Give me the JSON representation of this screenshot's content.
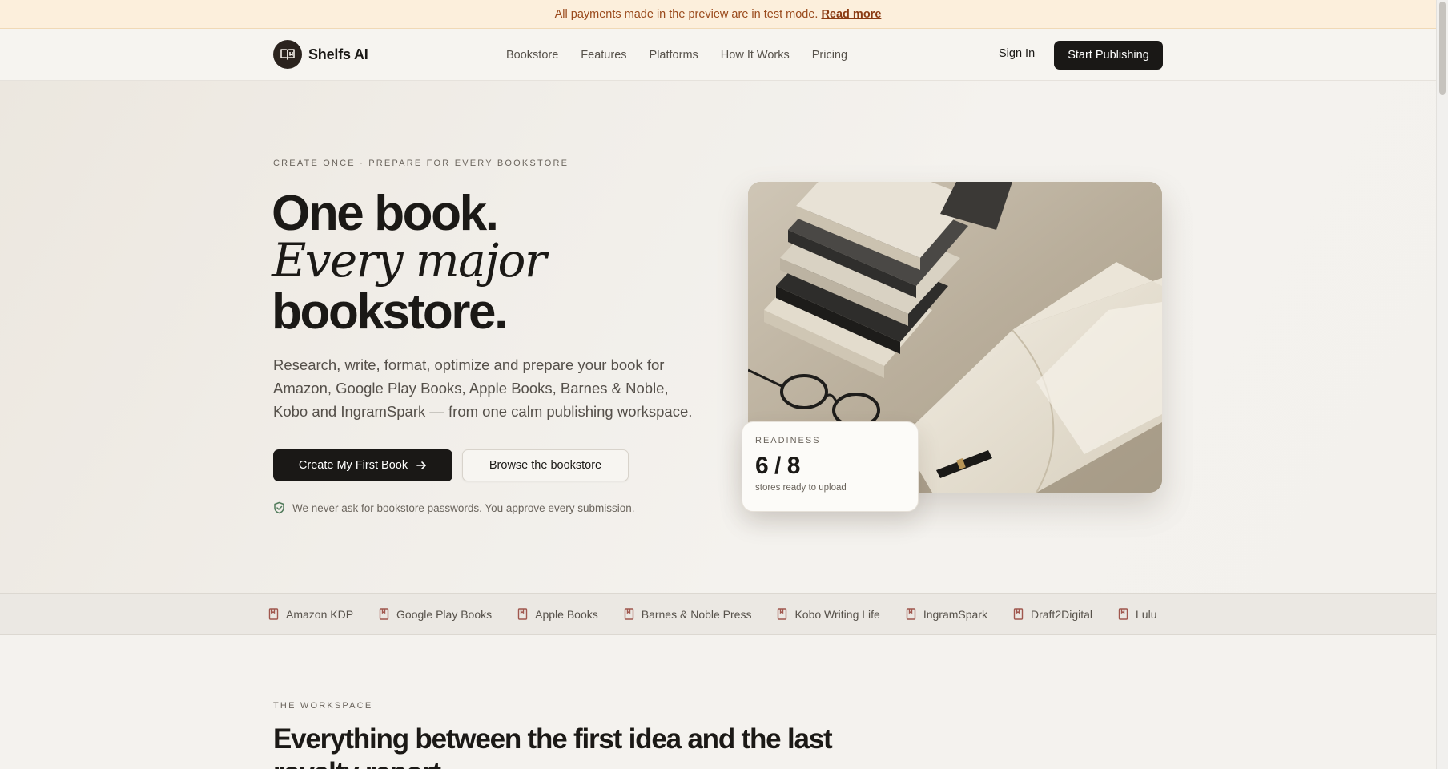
{
  "banner": {
    "text": "All payments made in the preview are in test mode.",
    "link": "Read more"
  },
  "header": {
    "brand": "Shelfs AI",
    "nav": [
      "Bookstore",
      "Features",
      "Platforms",
      "How It Works",
      "Pricing"
    ],
    "sign_in": "Sign In",
    "cta": "Start Publishing"
  },
  "hero": {
    "eyebrow": "CREATE ONCE · PREPARE FOR EVERY BOOKSTORE",
    "headline_1": "One book.",
    "headline_2": "Every major",
    "headline_3": "bookstore.",
    "lead": "Research, write, format, optimize and prepare your book for Amazon, Google Play Books, Apple Books, Barnes & Noble, Kobo and IngramSpark — from one calm publishing workspace.",
    "primary_cta": "Create My First Book",
    "secondary_cta": "Browse the bookstore",
    "trust_note": "We never ask for bookstore passwords. You approve every submission."
  },
  "readiness": {
    "label": "READINESS",
    "value": "6 / 8",
    "subtitle": "stores ready to upload"
  },
  "platforms": [
    "Amazon KDP",
    "Google Play Books",
    "Apple Books",
    "Barnes & Noble Press",
    "Kobo Writing Life",
    "IngramSpark",
    "Draft2Digital",
    "Lulu"
  ],
  "workspace": {
    "eyebrow": "THE WORKSPACE",
    "title": "Everything between the first idea and the last royalty report."
  },
  "colors": {
    "accent_dark": "#1a1816",
    "banner_bg": "#fcefdc",
    "banner_text": "#9a4a1c",
    "page_bg": "#f4f2ee",
    "platform_icon": "#a0574e"
  },
  "icons": {
    "logo": "open-book-icon",
    "cta_arrow": "arrow-right-icon",
    "trust": "shield-check-icon",
    "platform": "bookmark-book-icon"
  }
}
